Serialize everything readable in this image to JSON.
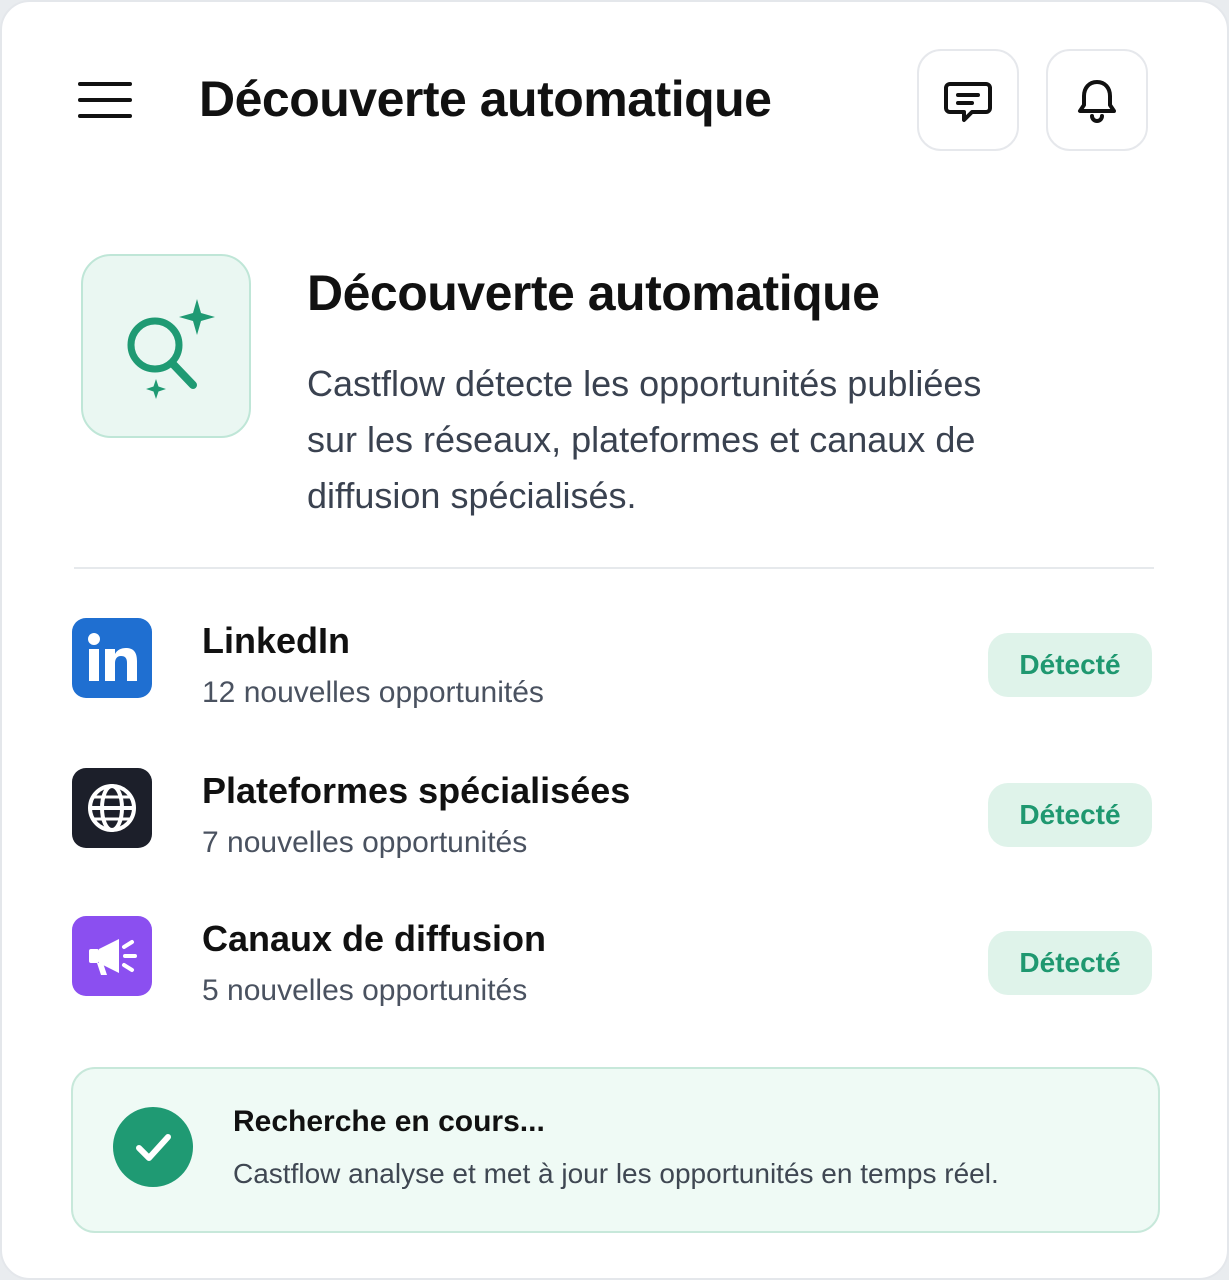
{
  "header": {
    "title": "Découverte automatique",
    "menu_icon": "hamburger-menu-icon",
    "message_icon": "message-icon",
    "notification_icon": "bell-icon"
  },
  "hero": {
    "icon": "sparkle-search-icon",
    "title": "Découverte automatique",
    "description": "Castflow détecte les opportunités publiées sur les réseaux, plateformes et canaux de diffusion spécialisés."
  },
  "sources": [
    {
      "name": "LinkedIn",
      "count_text": "12 nouvelles opportunités",
      "badge": "Détecté",
      "icon": "linkedin-icon",
      "icon_bg": "#1f6fd1"
    },
    {
      "name": "Plateformes spécialisées",
      "count_text": "7 nouvelles opportunités",
      "badge": "Détecté",
      "icon": "globe-icon",
      "icon_bg": "#1c1f2a"
    },
    {
      "name": "Canaux de diffusion",
      "count_text": "5 nouvelles opportunités",
      "badge": "Détecté",
      "icon": "megaphone-icon",
      "icon_bg": "#8b4ff0"
    }
  ],
  "status": {
    "icon": "check-circle-icon",
    "title": "Recherche en cours...",
    "description": "Castflow analyse et met à jour les opportunités en temps réel."
  },
  "colors": {
    "accent": "#1f9a73",
    "badge_bg": "#dff3ea",
    "badge_text": "#1f9870",
    "status_bg": "#effaf5"
  }
}
